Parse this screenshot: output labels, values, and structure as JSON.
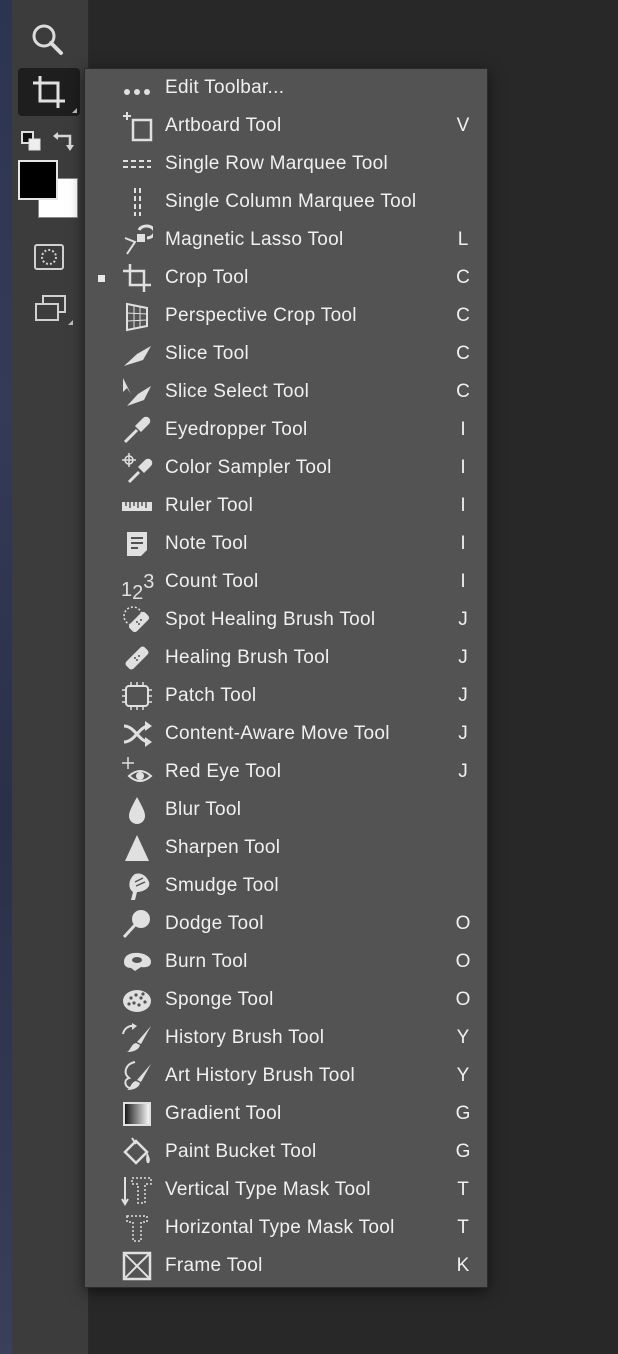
{
  "toolbar": {
    "tools": [
      "zoom-tool",
      "crop-tool",
      "quick-mask",
      "screen-mode"
    ]
  },
  "menu": {
    "items": [
      {
        "label": "Edit Toolbar...",
        "key": "",
        "icon": "dots-icon"
      },
      {
        "label": "Artboard Tool",
        "key": "V",
        "icon": "artboard-icon"
      },
      {
        "label": "Single Row Marquee Tool",
        "key": "",
        "icon": "single-row-marquee-icon"
      },
      {
        "label": "Single Column Marquee Tool",
        "key": "",
        "icon": "single-column-marquee-icon"
      },
      {
        "label": "Magnetic Lasso Tool",
        "key": "L",
        "icon": "magnetic-lasso-icon"
      },
      {
        "label": "Crop Tool",
        "key": "C",
        "icon": "crop-icon",
        "selected": true
      },
      {
        "label": "Perspective Crop Tool",
        "key": "C",
        "icon": "perspective-crop-icon"
      },
      {
        "label": "Slice Tool",
        "key": "C",
        "icon": "slice-icon"
      },
      {
        "label": "Slice Select Tool",
        "key": "C",
        "icon": "slice-select-icon"
      },
      {
        "label": "Eyedropper Tool",
        "key": "I",
        "icon": "eyedropper-icon"
      },
      {
        "label": "Color Sampler Tool",
        "key": "I",
        "icon": "color-sampler-icon"
      },
      {
        "label": "Ruler Tool",
        "key": "I",
        "icon": "ruler-icon"
      },
      {
        "label": "Note Tool",
        "key": "I",
        "icon": "note-icon"
      },
      {
        "label": "Count Tool",
        "key": "I",
        "icon": "count-icon",
        "icon_text": [
          "1",
          "2",
          "3"
        ]
      },
      {
        "label": "Spot Healing Brush Tool",
        "key": "J",
        "icon": "spot-healing-icon"
      },
      {
        "label": "Healing Brush Tool",
        "key": "J",
        "icon": "healing-brush-icon"
      },
      {
        "label": "Patch Tool",
        "key": "J",
        "icon": "patch-icon"
      },
      {
        "label": "Content-Aware Move Tool",
        "key": "J",
        "icon": "content-aware-move-icon"
      },
      {
        "label": "Red Eye Tool",
        "key": "J",
        "icon": "red-eye-icon"
      },
      {
        "label": "Blur Tool",
        "key": "",
        "icon": "blur-icon"
      },
      {
        "label": "Sharpen Tool",
        "key": "",
        "icon": "sharpen-icon"
      },
      {
        "label": "Smudge Tool",
        "key": "",
        "icon": "smudge-icon"
      },
      {
        "label": "Dodge Tool",
        "key": "O",
        "icon": "dodge-icon"
      },
      {
        "label": "Burn Tool",
        "key": "O",
        "icon": "burn-icon"
      },
      {
        "label": "Sponge Tool",
        "key": "O",
        "icon": "sponge-icon"
      },
      {
        "label": "History Brush Tool",
        "key": "Y",
        "icon": "history-brush-icon"
      },
      {
        "label": "Art History Brush Tool",
        "key": "Y",
        "icon": "art-history-brush-icon"
      },
      {
        "label": "Gradient Tool",
        "key": "G",
        "icon": "gradient-icon"
      },
      {
        "label": "Paint Bucket Tool",
        "key": "G",
        "icon": "paint-bucket-icon"
      },
      {
        "label": "Vertical Type Mask Tool",
        "key": "T",
        "icon": "vertical-type-mask-icon"
      },
      {
        "label": "Horizontal Type Mask Tool",
        "key": "T",
        "icon": "horizontal-type-mask-icon"
      },
      {
        "label": "Frame Tool",
        "key": "K",
        "icon": "frame-icon"
      }
    ]
  }
}
